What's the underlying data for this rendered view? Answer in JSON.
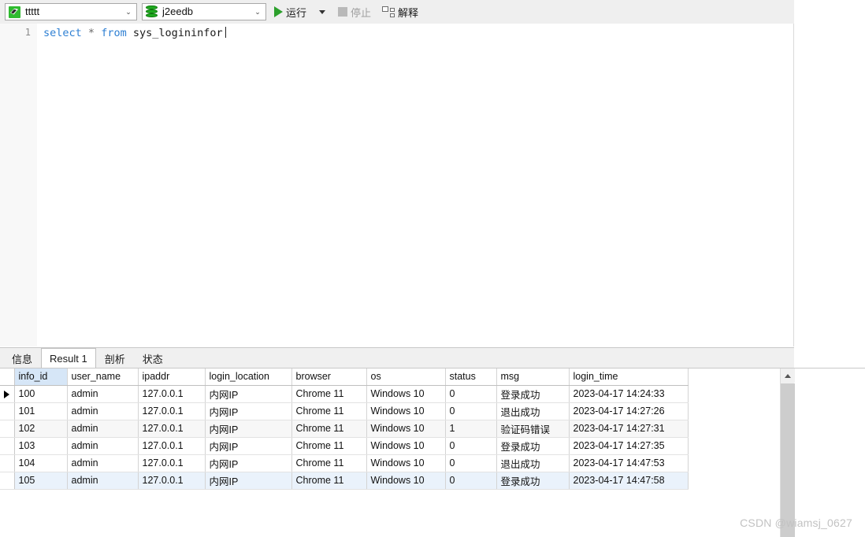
{
  "toolbar": {
    "connection": {
      "value": "ttttt",
      "icon": "connection-icon",
      "caret": "⌄"
    },
    "database": {
      "value": "j2eedb",
      "icon": "database-icon",
      "caret": "⌄"
    },
    "run_label": "运行",
    "stop_label": "停止",
    "explain_label": "解释"
  },
  "editor": {
    "line_number": "1",
    "sql": {
      "kw1": "select",
      "star": "*",
      "kw2": "from",
      "table": "sys_logininfor"
    }
  },
  "tabs": [
    {
      "label": "信息",
      "active": false
    },
    {
      "label": "Result 1",
      "active": true
    },
    {
      "label": "剖析",
      "active": false
    },
    {
      "label": "状态",
      "active": false
    }
  ],
  "grid": {
    "columns": [
      "info_id",
      "user_name",
      "ipaddr",
      "login_location",
      "browser",
      "os",
      "status",
      "msg",
      "login_time"
    ],
    "selected_column": "info_id",
    "rows": [
      {
        "current": true,
        "cells": [
          "100",
          "admin",
          "127.0.0.1",
          "内网IP",
          "Chrome 11",
          "Windows 10",
          "0",
          "登录成功",
          "2023-04-17 14:24:33"
        ]
      },
      {
        "current": false,
        "cells": [
          "101",
          "admin",
          "127.0.0.1",
          "内网IP",
          "Chrome 11",
          "Windows 10",
          "0",
          "退出成功",
          "2023-04-17 14:27:26"
        ]
      },
      {
        "current": false,
        "cells": [
          "102",
          "admin",
          "127.0.0.1",
          "内网IP",
          "Chrome 11",
          "Windows 10",
          "1",
          "验证码错误",
          "2023-04-17 14:27:31"
        ]
      },
      {
        "current": false,
        "cells": [
          "103",
          "admin",
          "127.0.0.1",
          "内网IP",
          "Chrome 11",
          "Windows 10",
          "0",
          "登录成功",
          "2023-04-17 14:27:35"
        ]
      },
      {
        "current": false,
        "cells": [
          "104",
          "admin",
          "127.0.0.1",
          "内网IP",
          "Chrome 11",
          "Windows 10",
          "0",
          "退出成功",
          "2023-04-17 14:47:53"
        ]
      },
      {
        "current": false,
        "cells": [
          "105",
          "admin",
          "127.0.0.1",
          "内网IP",
          "Chrome 11",
          "Windows 10",
          "0",
          "登录成功",
          "2023-04-17 14:47:58"
        ]
      }
    ]
  },
  "watermark": "CSDN @wiamsj_0627",
  "colors": {
    "toolbar_bg": "#efefef",
    "keyword": "#2d7fd3",
    "run_green": "#2ca02c",
    "selected_header": "#d6e6f7",
    "selected_row": "#eaf2fb"
  }
}
